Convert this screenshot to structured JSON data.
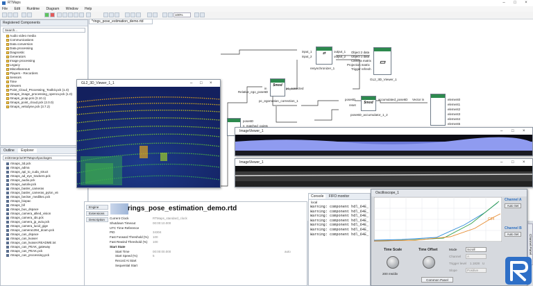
{
  "app": {
    "title": "RTMaps"
  },
  "menu": [
    "File",
    "Edit",
    "Runtime",
    "Diagram",
    "Window",
    "Help"
  ],
  "toolbar": {
    "zoom": "100%"
  },
  "components_panel": {
    "title": "Registered Components",
    "search_placeholder": "Search...",
    "items": [
      "Audio video media",
      "Communications",
      "Data conversion",
      "Data processing",
      "Diagnostic",
      "Generators",
      "Image processing",
      "Legacy",
      "Miscellaneous",
      "Players - Recorders",
      "Sensors",
      "Time",
      "Viewers",
      "Point_Cloud_Processing_Toolkit.pck (1.0)",
      "rtmaps_image_processing_opencv.pck (1.0)",
      "rtmaps_pcap.pck (3.10.1)",
      "rtmaps_point_cloud.pck (2.0.0)",
      "rtmaps_velodyne.pck (3.7.2)"
    ]
  },
  "explorer_panel": {
    "tabs": [
      "Outline",
      "Explorer"
    ],
    "path": "es\\Enterprise\\RTMaps4\\packages",
    "items": [
      "rtmaps_3d.pck",
      "rtmaps_adma",
      "rtmaps_api_to_cuda_struct",
      "rtmaps_ad_eye_trackers.pck",
      "rtmaps_audio.pck",
      "rtmaps_autoliv.pck",
      "rtmaps_basler_cameras",
      "rtmaps_basler_cameras_pylon_v6",
      "rtmaps_becker_mediltec.pck",
      "rtmaps_biopac",
      "rtmaps_bll",
      "rtmaps_bus_dspace",
      "rtmaps_camera_allied_vision",
      "rtmaps_camera_ids.pck",
      "rtmaps_camera_jp_avia.pck",
      "rtmaps_camera_lucid_gige",
      "rtmaps_camera1394_dcam.pck",
      "rtmaps_can_dspace",
      "rtmaps_can_kvaser",
      "rtmaps_can_kvaser.README.txt",
      "rtmaps_can_PEAK_gateway",
      "rtmaps_can_PEAK.pck",
      "rtmaps_can_processing.pck"
    ]
  },
  "editor": {
    "tab_label": "*rings_pose_estimation_demo.rtd"
  },
  "diagram": {
    "resynchronizer": {
      "name": "resynchronizer_1",
      "inputs": [
        "input_1",
        "input_2"
      ],
      "outputs": [
        "output_1",
        "output_2"
      ]
    },
    "gl_viewer_block": {
      "name": "GL2_3D_Viewer_1",
      "inputs": [
        "Object 2 data",
        "Object 1 data",
        "Camera matrix",
        "Projection matrix",
        "Trigger refresh"
      ]
    },
    "icp": {
      "name": "pc_egomotion_correction_1",
      "label": "Relative_ego_pose6D",
      "port_in": "in",
      "port_out": "pc_corrected",
      "tag": "$mod"
    },
    "accumulator": {
      "name": "pose6D_accumulator_1_2",
      "port_in": "pose6D",
      "port_reset": "reset",
      "port_out": "accumulated_pose6D",
      "tag": "$mod"
    },
    "vector_in": {
      "label": "Vector in",
      "outputs": [
        "element0",
        "element1",
        "element2",
        "element3",
        "element4",
        "element5"
      ]
    },
    "matcher": {
      "ports": [
        "pose6D",
        "n_matched_points"
      ]
    }
  },
  "gl3d_window": {
    "title": "GL2_3D_Viewer_1_1"
  },
  "image_viewers": [
    {
      "title": "ImageViewer_1"
    },
    {
      "title": "ImageViewer_1"
    }
  ],
  "normal_image_label": "normal_image",
  "properties": {
    "tabs": [
      "Engine",
      "Extensions",
      "Description"
    ],
    "heading": "rings_pose_estimation_demo.rtd",
    "rows": [
      {
        "label": "Current Clock",
        "value": "RTMaps_standard_clock"
      },
      {
        "label": "Shutdown Timeout",
        "value": "00:00:10.000"
      },
      {
        "label": "UTC Time Reference",
        "value": ""
      },
      {
        "label": "PID",
        "value": "34304"
      },
      {
        "label": "Fast Forward Threshold (%)",
        "value": "100"
      },
      {
        "label": "Fast Rewind Threshold (%)",
        "value": "100"
      }
    ],
    "section": "Start State",
    "start_rows": [
      {
        "label": "Start Time",
        "value": "00:00:00.000",
        "extra": "auto"
      },
      {
        "label": "Start Speed (%)",
        "value": "5"
      },
      {
        "label": "Record At Start",
        "value": ""
      },
      {
        "label": "Sequential Start",
        "value": ""
      }
    ]
  },
  "console": {
    "tabs": [
      "Console",
      "FIFO monitor"
    ],
    "header": "local",
    "lines": [
      "Warning: component hdl_64E_",
      "Warning: component hdl_64E_",
      "Warning: component hdl_64E_",
      "Warning: component hdl_64E_",
      "Warning: component hdl_64E_",
      "Warning: component hdl_64E_",
      "Warning: component hdl_64E_"
    ]
  },
  "oscilloscope": {
    "title": "Oscilloscope_1",
    "time_scale_label": "Time Scale",
    "time_scale_value": "200 ms/div",
    "time_offset_label": "Time Offset",
    "mode_label": "Mode",
    "mode_value": "Scroll",
    "channel_label": "Channel",
    "channel_value": "A",
    "trigger_label": "Trigger level",
    "trigger_value": "1.1828",
    "trigger_unit": "U",
    "slope_label": "Slope",
    "slope_value": "Positive",
    "channel_a": "Channel A",
    "channel_b": "Channel B",
    "auto_set": "Auto Set",
    "common_panel": "Common Panel",
    "side_tab": "Channel Panel",
    "value_label": "C24",
    "colors": {
      "trace_a": "#2c8ad8",
      "trace_b": "#35a14a",
      "trace_c": "#e6892c",
      "screen": "#ffffff"
    }
  }
}
